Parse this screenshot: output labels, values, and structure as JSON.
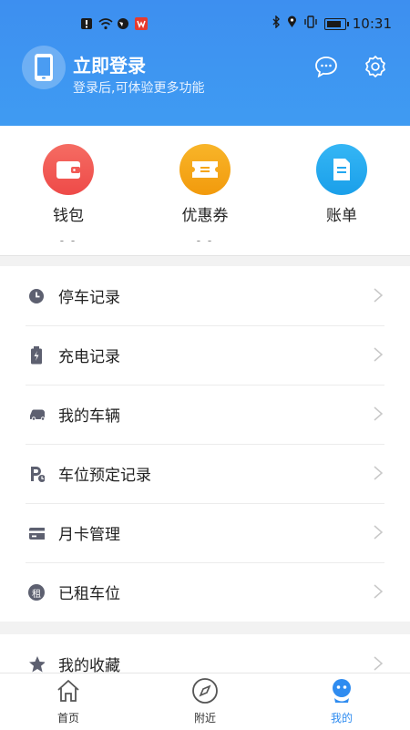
{
  "status_bar": {
    "time": "10:31"
  },
  "header": {
    "title": "立即登录",
    "subtitle": "登录后,可体验更多功能",
    "message_icon": "message-icon",
    "settings_icon": "settings-icon"
  },
  "quick_actions": [
    {
      "label": "钱包",
      "value": "- -",
      "color": "#f25a55",
      "icon": "wallet-icon"
    },
    {
      "label": "优惠券",
      "value": "- -",
      "color": "#f5a516",
      "icon": "coupon-icon"
    },
    {
      "label": "账单",
      "value": "",
      "color": "#22a7f0",
      "icon": "bill-icon"
    }
  ],
  "menu": [
    {
      "label": "停车记录",
      "icon": "clock-icon"
    },
    {
      "label": "充电记录",
      "icon": "battery-charge-icon"
    },
    {
      "label": "我的车辆",
      "icon": "car-icon"
    },
    {
      "label": "车位预定记录",
      "icon": "parking-reserve-icon"
    },
    {
      "label": "月卡管理",
      "icon": "card-icon"
    },
    {
      "label": "已租车位",
      "icon": "rent-icon",
      "icon_text": "租"
    }
  ],
  "menu2": [
    {
      "label": "我的收藏",
      "icon": "star-icon"
    }
  ],
  "bottom_nav": [
    {
      "label": "首页",
      "icon": "home-icon"
    },
    {
      "label": "附近",
      "icon": "compass-icon"
    },
    {
      "label": "我的",
      "icon": "profile-icon",
      "active": true
    }
  ],
  "colors": {
    "header_blue": "#3d8ff0",
    "active_tab": "#2f8cf0",
    "icon_gray": "#5d6070"
  }
}
